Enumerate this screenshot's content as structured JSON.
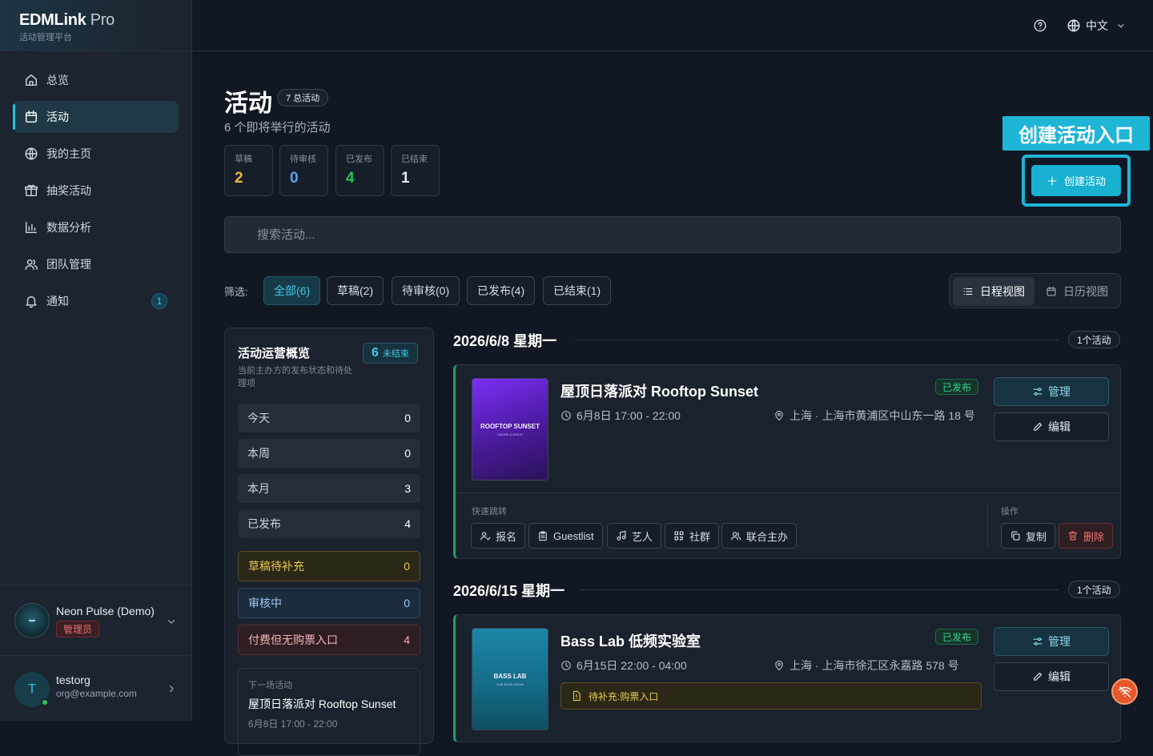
{
  "app": {
    "brand_main": "EDMLink",
    "brand_pro": " Pro",
    "brand_sub": "活动管理平台"
  },
  "sidebar": {
    "items": [
      {
        "label": "总览"
      },
      {
        "label": "活动"
      },
      {
        "label": "我的主页"
      },
      {
        "label": "抽奖活动"
      },
      {
        "label": "数据分析"
      },
      {
        "label": "团队管理"
      },
      {
        "label": "通知",
        "badge": "1"
      }
    ],
    "account": {
      "name": "Neon Pulse (Demo)",
      "role": "管理员"
    },
    "user": {
      "initial": "T",
      "name": "testorg",
      "email": "org@example.com"
    }
  },
  "topbar": {
    "language": "中文"
  },
  "page": {
    "title": "活动",
    "total_badge": "7 总活动",
    "subtitle": "6 个即将举行的活动",
    "stats": [
      {
        "label": "草稿",
        "value": "2",
        "color": "#f0b43a"
      },
      {
        "label": "待审核",
        "value": "0",
        "color": "#5aa3f0"
      },
      {
        "label": "已发布",
        "value": "4",
        "color": "#22c55e"
      },
      {
        "label": "已结束",
        "value": "1",
        "color": "#e6ebf2"
      }
    ],
    "callout": "创建活动入口",
    "create_button": "创建活动",
    "search_placeholder": "搜索活动...",
    "filter_label": "筛选:",
    "filters": [
      "全部(6)",
      "草稿(2)",
      "待审核(0)",
      "已发布(4)",
      "已结束(1)"
    ],
    "views": {
      "schedule": "日程视图",
      "calendar": "日历视图"
    }
  },
  "overview": {
    "title": "活动运营概览",
    "desc": "当前主办方的发布状态和待处理项",
    "open_count": "6",
    "open_label": "未结束",
    "rows": [
      {
        "label": "今天",
        "value": "0"
      },
      {
        "label": "本周",
        "value": "0"
      },
      {
        "label": "本月",
        "value": "3"
      },
      {
        "label": "已发布",
        "value": "4"
      }
    ],
    "alerts": [
      {
        "label": "草稿待补充",
        "value": "0"
      },
      {
        "label": "审核中",
        "value": "0"
      },
      {
        "label": "付费但无购票入口",
        "value": "4"
      }
    ],
    "next": {
      "label": "下一场活动",
      "title": "屋顶日落派对 Rooftop Sunset",
      "time": "6月8日 17:00 - 22:00"
    }
  },
  "groups": [
    {
      "date": "2026/6/8 星期一",
      "count": "1个活动",
      "event": {
        "poster_title": "ROOFTOP SUNSET",
        "poster_sub": "HOUSE & DISCO",
        "title": "屋顶日落派对 Rooftop Sunset",
        "time": "6月8日 17:00 - 22:00",
        "location": "上海 · 上海市黄浦区中山东一路 18 号",
        "status": "已发布",
        "manage": "管理",
        "edit": "编辑",
        "quick_label": "快速跳转",
        "quick": [
          "报名",
          "Guestlist",
          "艺人",
          "社群",
          "联合主办"
        ],
        "ops_label": "操作",
        "copy": "复制",
        "delete": "删除"
      }
    },
    {
      "date": "2026/6/15 星期一",
      "count": "1个活动",
      "event": {
        "poster_title": "BASS LAB",
        "poster_sub": "SUB-BASS ROOM",
        "title": "Bass Lab 低频实验室",
        "time": "6月15日 22:00 - 04:00",
        "location": "上海 · 上海市徐汇区永嘉路 578 号",
        "status": "已发布",
        "manage": "管理",
        "edit": "编辑",
        "pending": "待补充:购票入口"
      }
    }
  ]
}
